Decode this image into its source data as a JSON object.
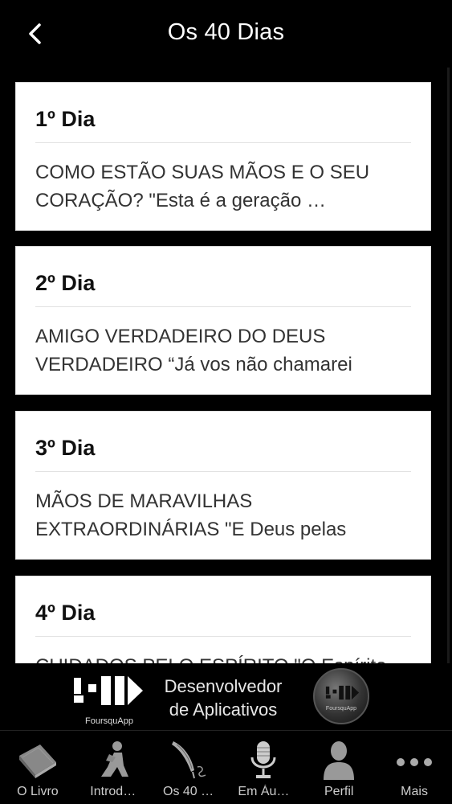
{
  "nav": {
    "title": "Os 40 Dias",
    "back_icon": "chevron-left-icon"
  },
  "cards": [
    {
      "title": "1º Dia",
      "line1": "COMO ESTÃO SUAS MÃOS E O SEU",
      "line2": "CORAÇÃO?   \"Esta é a geração …"
    },
    {
      "title": "2º Dia",
      "line1": "AMIGO VERDADEIRO DO DEUS",
      "line2": "VERDADEIRO   “Já vos não chamarei"
    },
    {
      "title": "3º Dia",
      "line1": "MÃOS DE MARAVILHAS",
      "line2": "EXTRAORDINÁRIAS   \"E Deus pelas"
    },
    {
      "title": "4º Dia",
      "line1": "CUIDADOS PELO ESPÍRITO   \"O Espírito",
      "line2": ""
    }
  ],
  "banner": {
    "logo_name": "FoursquApp",
    "line1": "Desenvolvedor",
    "line2": "de Aplicativos",
    "badge_name": "FoursquApp"
  },
  "tabs": [
    {
      "label": "O Livro",
      "icon": "book-icon"
    },
    {
      "label": "Introd…",
      "icon": "praying-person-icon"
    },
    {
      "label": "Os 40 …",
      "icon": "quill-pen-icon"
    },
    {
      "label": "Em Áu…",
      "icon": "microphone-icon"
    },
    {
      "label": "Perfil",
      "icon": "person-icon"
    },
    {
      "label": "Mais",
      "icon": "more-dots-icon"
    }
  ],
  "colors": {
    "background": "#000000",
    "card": "#ffffff",
    "text_dark": "#111111",
    "tab_label": "#cccccc"
  }
}
